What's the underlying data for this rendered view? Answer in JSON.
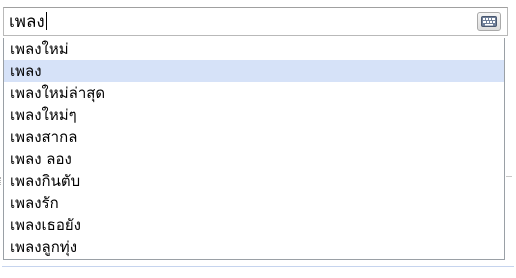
{
  "search": {
    "value": "เพลง"
  },
  "keyboard_button": {
    "icon": "keyboard-icon"
  },
  "suggestions": [
    {
      "label": "เพลงใหม่"
    },
    {
      "label": "เพลง"
    },
    {
      "label": "เพลงใหม่ล่าสุด"
    },
    {
      "label": "เพลงใหม่ๆ"
    },
    {
      "label": "เพลงสากล"
    },
    {
      "label": "เพลง ลอง"
    },
    {
      "label": "เพลงกินตับ"
    },
    {
      "label": "เพลงรัก"
    },
    {
      "label": "เพลงเธอยัง"
    },
    {
      "label": "เพลงลูกทุ่ง"
    }
  ],
  "colors": {
    "selected_row": "#d6e2f8",
    "border": "#9aa0a6"
  }
}
